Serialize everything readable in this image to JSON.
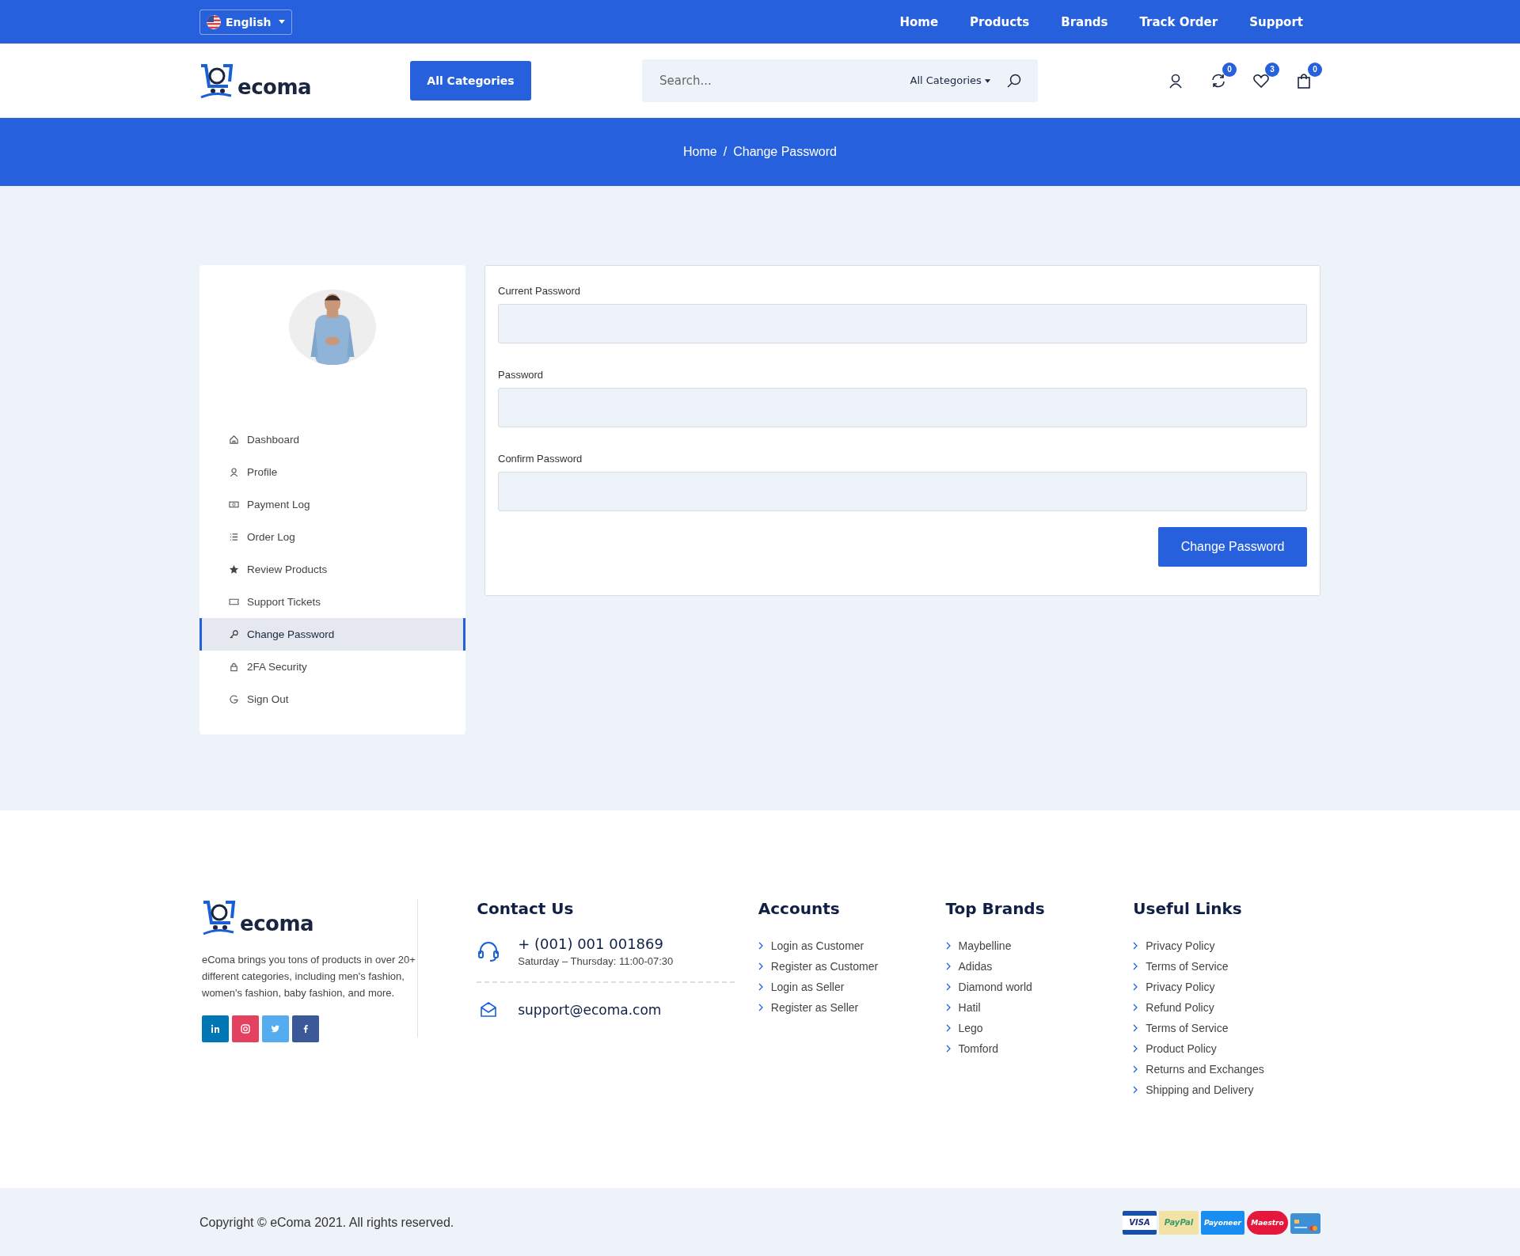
{
  "top_bar": {
    "language": "English",
    "nav": [
      "Home",
      "Products",
      "Brands",
      "Track Order",
      "Support"
    ]
  },
  "header": {
    "logo": "ecoma",
    "categories_button": "All Categories",
    "search": {
      "placeholder": "Search...",
      "category": "All Categories"
    },
    "icons": [
      {
        "kind": "user"
      },
      {
        "kind": "compare",
        "count": "0"
      },
      {
        "kind": "wishlist",
        "count": "3"
      },
      {
        "kind": "cart",
        "count": "0"
      }
    ]
  },
  "breadcrumb": {
    "separator": "/",
    "items": [
      "Home",
      "Change Password"
    ]
  },
  "sidebar": {
    "items": [
      {
        "label": "Dashboard",
        "kind": "home",
        "selected": false
      },
      {
        "label": "Profile",
        "kind": "user",
        "selected": false
      },
      {
        "label": "Payment Log",
        "kind": "money",
        "selected": false
      },
      {
        "label": "Order Log",
        "kind": "list",
        "selected": false
      },
      {
        "label": "Review Products",
        "kind": "star",
        "selected": false
      },
      {
        "label": "Support Tickets",
        "kind": "ticket",
        "selected": false
      },
      {
        "label": "Change Password",
        "kind": "key",
        "selected": true
      },
      {
        "label": "2FA Security",
        "kind": "lock",
        "selected": false
      },
      {
        "label": "Sign Out",
        "kind": "signout",
        "selected": false
      }
    ]
  },
  "form": {
    "fields": [
      {
        "label": "Current Password"
      },
      {
        "label": "Password"
      },
      {
        "label": "Confirm Password"
      }
    ],
    "submit": "Change Password"
  },
  "footer": {
    "logo": "ecoma",
    "about": "eComa brings you tons of products in over 20+ different categories, including men's fashion, women's fashion, baby fashion, and more.",
    "social": [
      {
        "kind": "linkedin",
        "color": "#0077b5"
      },
      {
        "kind": "instagram",
        "color": "#e4405f"
      },
      {
        "kind": "twitter",
        "color": "#55acee"
      },
      {
        "kind": "facebook",
        "color": "#3b5998"
      }
    ],
    "contact": {
      "title": "Contact Us",
      "phone": "+ (001) 001 001869",
      "hours": "Saturday – Thursday: 11:00-07:30",
      "email": "support@ecoma.com"
    },
    "columns": [
      {
        "title": "Accounts",
        "links": [
          "Login as Customer",
          "Register as Customer",
          "Login as Seller",
          "Register as Seller"
        ]
      },
      {
        "title": "Top Brands",
        "links": [
          "Maybelline",
          "Adidas",
          "Diamond world",
          "Hatil",
          "Lego",
          "Tomford"
        ]
      },
      {
        "title": "Useful Links",
        "links": [
          "Privacy Policy",
          "Terms of Service",
          "Privacy Policy",
          "Refund Policy",
          "Terms of Service",
          "Product Policy",
          "Returns and Exchanges",
          "Shipping and Delivery"
        ]
      }
    ]
  },
  "bottom_bar": {
    "copyright": "Copyright © eComa 2021. All rights reserved.",
    "payments": [
      {
        "kind": "visa",
        "label": "VISA"
      },
      {
        "kind": "paypal",
        "label": "PayPal"
      },
      {
        "kind": "payoneer",
        "label": "Payoneer"
      },
      {
        "kind": "maestro",
        "label": "Maestro"
      },
      {
        "kind": "card"
      }
    ]
  }
}
